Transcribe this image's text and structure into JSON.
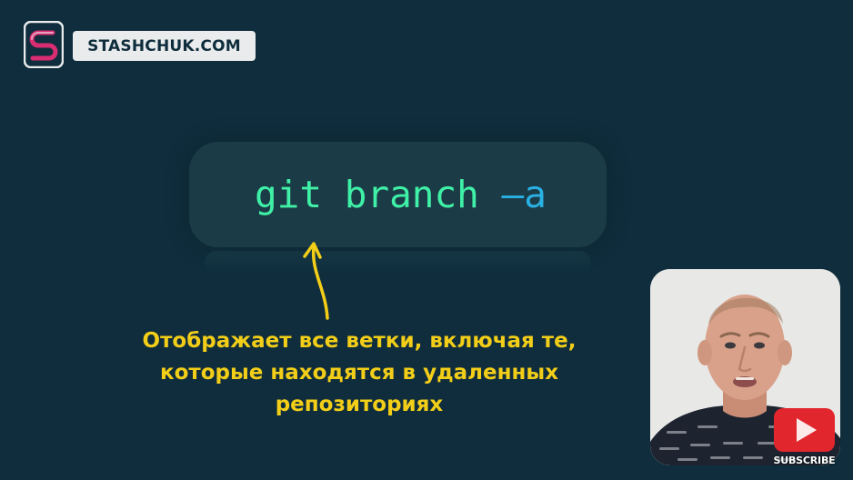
{
  "branding": {
    "site_name": "STASHCHUK.COM",
    "logo_letter": "S"
  },
  "command": {
    "base": "git branch ",
    "flag": "–a"
  },
  "caption": {
    "lines": [
      "Отображает все ветки, включая те,",
      "которые находятся в удаленных",
      "репозиториях"
    ]
  },
  "subscribe": {
    "label": "SUBSCRIBE"
  },
  "colors": {
    "background": "#0f2d3c",
    "command_box": "#1b3b47",
    "command_text": "#3ff0a6",
    "flag_text": "#2ab1e4",
    "caption_text": "#f3ce18",
    "logo_accent": "#d92d72",
    "subscribe_red": "#e1262d"
  },
  "icons": {
    "logo": "stashchuk-logo-icon",
    "arrow": "curved-arrow-up-icon",
    "subscribe": "youtube-play-icon"
  }
}
